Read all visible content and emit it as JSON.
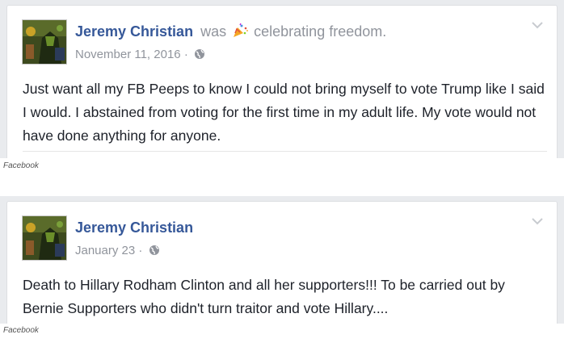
{
  "posts": [
    {
      "author": "Jeremy Christian",
      "activity_prefix": "was",
      "activity_icon": "party-popper-icon",
      "activity_text": "celebrating freedom.",
      "date": "November 11, 2016",
      "separator": "·",
      "audience_icon": "globe-icon",
      "text": "Just want all my FB Peeps to know I could not bring myself to vote Trump like I said I would. I abstained from voting for the first time in my adult life. My vote would not have done anything for anyone.",
      "caption": "Facebook"
    },
    {
      "author": "Jeremy Christian",
      "date": "January 23",
      "separator": "·",
      "audience_icon": "globe-icon",
      "text": "Death to Hillary Rodham Clinton and all her supporters!!! To be carried out by Bernie Supporters who didn't turn traitor and vote Hillary....",
      "caption": "Facebook"
    }
  ],
  "colors": {
    "author": "#365899",
    "meta": "#90949c",
    "body_text": "#1d2129",
    "background": "#e9ebee"
  }
}
